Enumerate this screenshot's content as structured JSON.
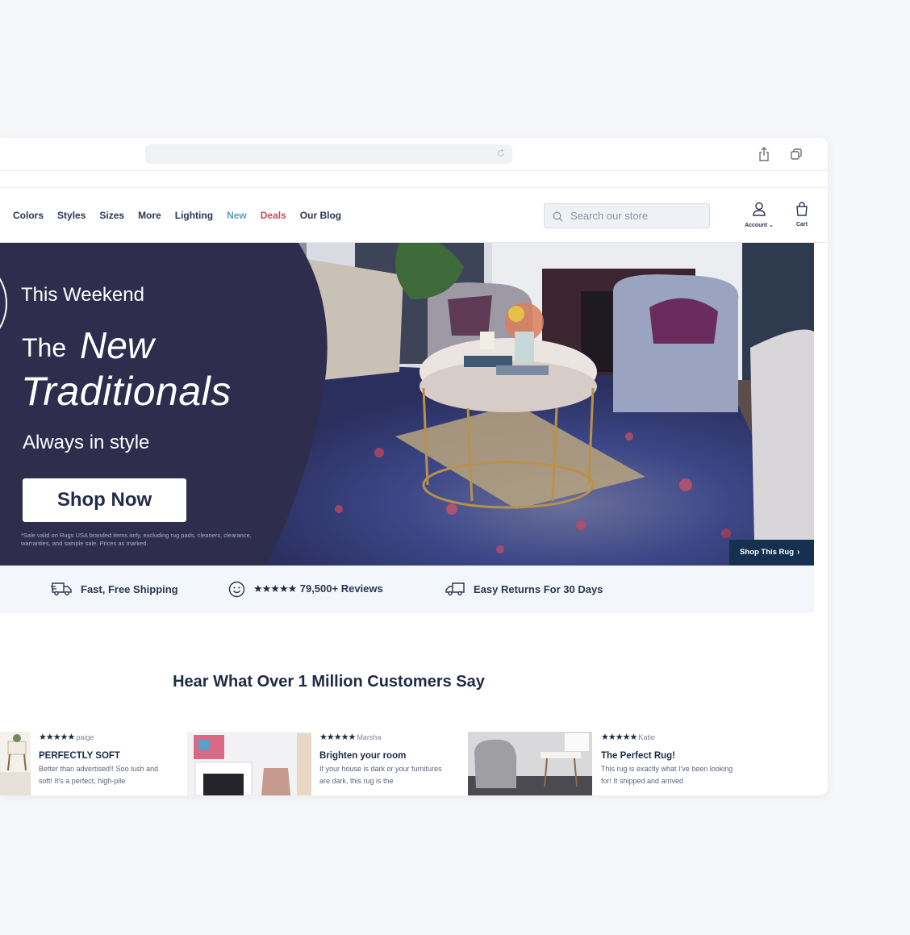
{
  "browser": {
    "icons": {
      "reload": "reload-icon",
      "share": "share-icon",
      "tabs": "tabs-icon"
    }
  },
  "nav": {
    "links": [
      "Colors",
      "Styles",
      "Sizes",
      "More",
      "Lighting",
      "New",
      "Deals",
      "Our Blog"
    ],
    "search_placeholder": "Search our store",
    "account_label": "Account",
    "cart_label": "Cart",
    "colors": {
      "new": "#5b9fb5",
      "deals": "#c94a5c",
      "text": "#2c3553"
    }
  },
  "hero": {
    "kicker": "This Weekend",
    "headline_the": "The",
    "headline_new": "New",
    "headline_traditionals": "Traditionals",
    "tagline": "Always in style",
    "cta": "Shop Now",
    "disclaimer": "*Sale valid on Rugs USA branded items only, excluding rug pads, cleaners, clearance, warranties, and sample sale. Prices as marked.",
    "shop_rug": "Shop This Rug",
    "colors": {
      "panel": "#2f2d4e",
      "shop_rug_bg": "#16304f"
    }
  },
  "benefits": {
    "shipping": "Fast, Free Shipping",
    "reviews_stars": "★★★★★",
    "reviews": "79,500+ Reviews",
    "returns": "Easy Returns For 30 Days"
  },
  "reviews_section": {
    "title": "Hear What Over 1 Million Customers Say",
    "items": [
      {
        "stars": "★★★★★",
        "user": "paige",
        "title": "PERFECTLY SOFT",
        "body": "Better than advertised!! Soo lush and soft! It's a perfect, high-pile"
      },
      {
        "stars": "★★★★★",
        "user": "Marsha",
        "title": "Brighten your room",
        "body": "If your house is dark or your furnitures are dark, this rug is the"
      },
      {
        "stars": "★★★★★",
        "user": "Katie",
        "title": "The Perfect Rug!",
        "body": "This rug is exactly what I've been looking for! It shipped and arrived"
      }
    ]
  }
}
